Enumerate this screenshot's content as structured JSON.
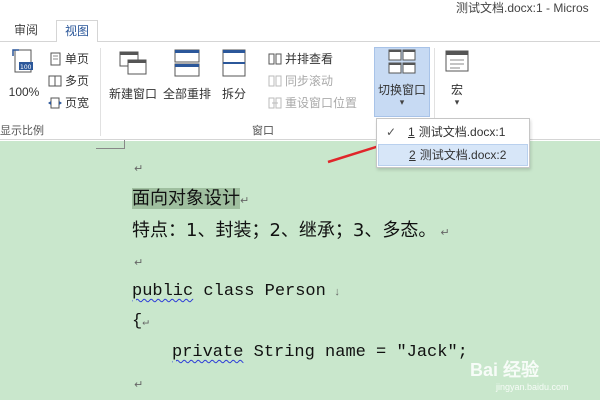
{
  "window": {
    "title": "测试文档.docx:1 - Micros"
  },
  "tabs": {
    "review": "审阅",
    "view": "视图"
  },
  "ribbon": {
    "zoom100": "100%",
    "single_page": "单页",
    "multi_page": "多页",
    "page_width": "页宽",
    "zoom_group_label": "显示比例",
    "new_window": "新建窗口",
    "arrange_all": "全部重排",
    "split": "拆分",
    "side_by_side": "并排查看",
    "sync_scroll": "同步滚动",
    "reset_window": "重设窗口位置",
    "switch_window": "切换窗口",
    "macros": "宏",
    "window_group_label": "窗口",
    "dropdown_arrow": "▾"
  },
  "menu": {
    "items": [
      {
        "num": "1",
        "label": "测试文档.docx:1",
        "checked": true
      },
      {
        "num": "2",
        "label": "测试文档.docx:2",
        "checked": false
      }
    ],
    "check_mark": "✓"
  },
  "document": {
    "line_title": "面向对象设计",
    "line_features": "特点：1、封装；2、继承；3、多态。",
    "code_public": "public",
    "code_class_rest": " class Person",
    "code_brace": "{",
    "code_private": "private",
    "code_field_rest": " String name = \"Jack\";",
    "return_mark": "↵",
    "down_mark": "↓"
  },
  "watermark": {
    "text": "Bai 经验",
    "sub": "jingyan.baidu.com"
  },
  "colors": {
    "doc_background": "#c9e7cc",
    "accent": "#2b579a",
    "arrow": "#e0262a"
  }
}
